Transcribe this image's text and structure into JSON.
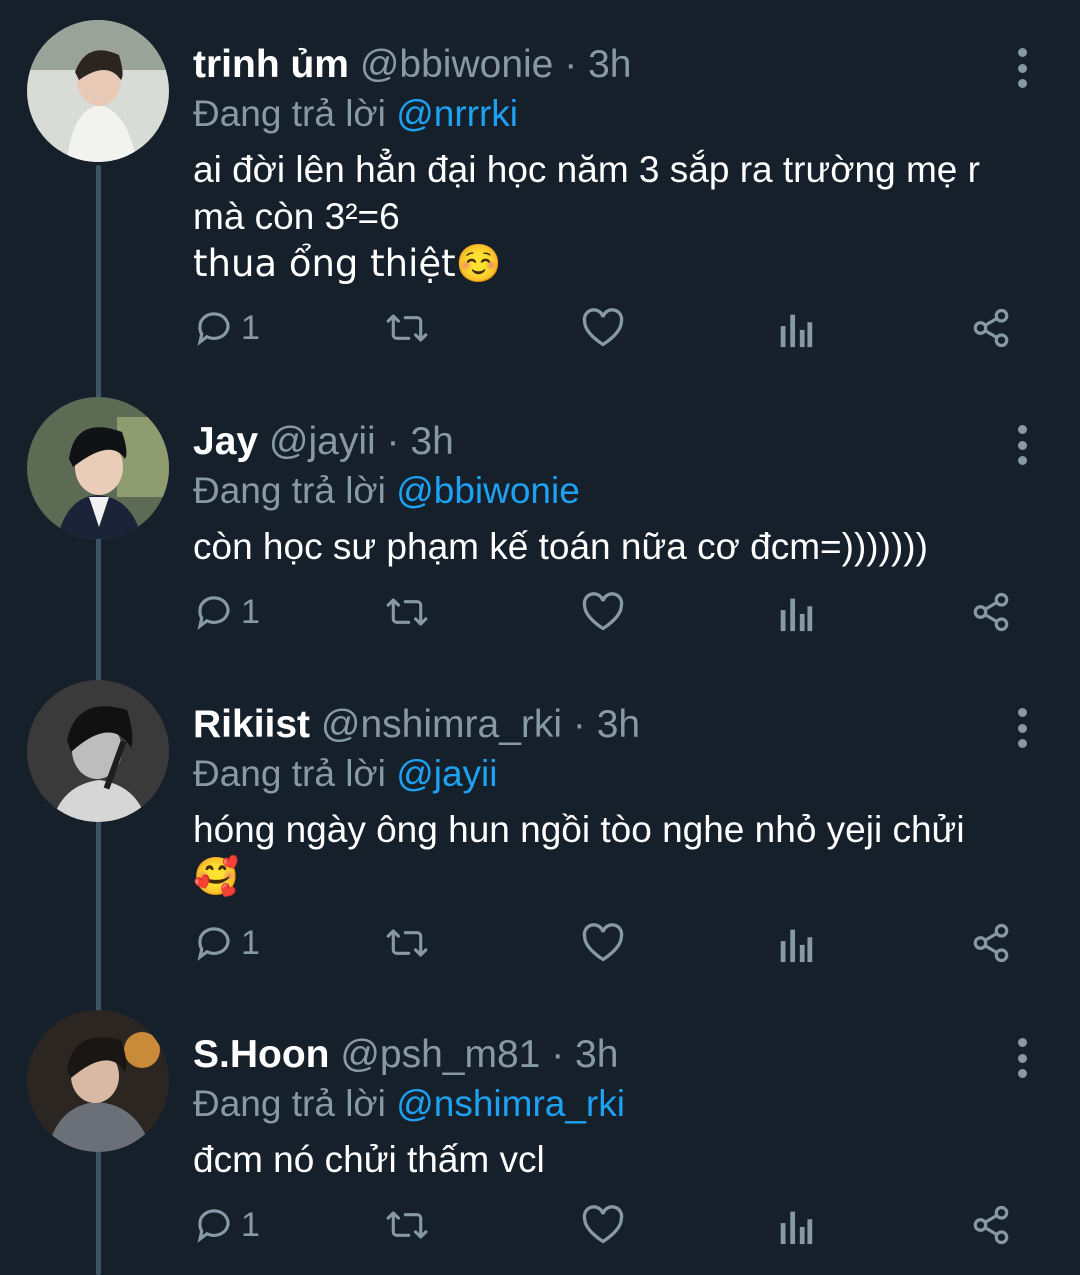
{
  "replying_prefix": "Đang trả lời",
  "tweets": [
    {
      "display_name": "trinh ủm",
      "handle": "@bbiwonie",
      "separator": "·",
      "time": "3h",
      "reply_to": "@nrrrki",
      "text_lines": [
        "ai đời lên hẳn đại học năm 3 sắp ra trường mẹ r",
        "mà còn 3²=6",
        "thua ổng thiệt☺️"
      ],
      "reply_count": "1",
      "avatar_icon": "profile-photo"
    },
    {
      "display_name": "Jay",
      "handle": "@jayii",
      "separator": "·",
      "time": "3h",
      "reply_to": "@bbiwonie",
      "text_lines": [
        "còn học sư phạm kế toán nữa cơ đcm=)))))))"
      ],
      "reply_count": "1",
      "avatar_icon": "profile-photo"
    },
    {
      "display_name": "Rikiist",
      "handle": "@nshimra_rki",
      "separator": "·",
      "time": "3h",
      "reply_to": "@jayii",
      "text_lines": [
        "hóng ngày ông hun ngồi tòo nghe nhỏ yeji chửi",
        "🥰"
      ],
      "reply_count": "1",
      "avatar_icon": "profile-photo"
    },
    {
      "display_name": "S.Hoon",
      "handle": "@psh_m81",
      "separator": "·",
      "time": "3h",
      "reply_to": "@nshimra_rki",
      "text_lines": [
        "đcm nó chửi thấm vcl"
      ],
      "reply_count": "1",
      "avatar_icon": "profile-photo"
    }
  ],
  "action_icons": [
    "reply-icon",
    "retweet-icon",
    "like-icon",
    "analytics-icon",
    "share-icon"
  ],
  "colors": {
    "background": "#15202b",
    "text_primary": "#ffffff",
    "text_secondary": "#8899a6",
    "accent": "#1da1f2",
    "thread_line": "#3d5466"
  }
}
